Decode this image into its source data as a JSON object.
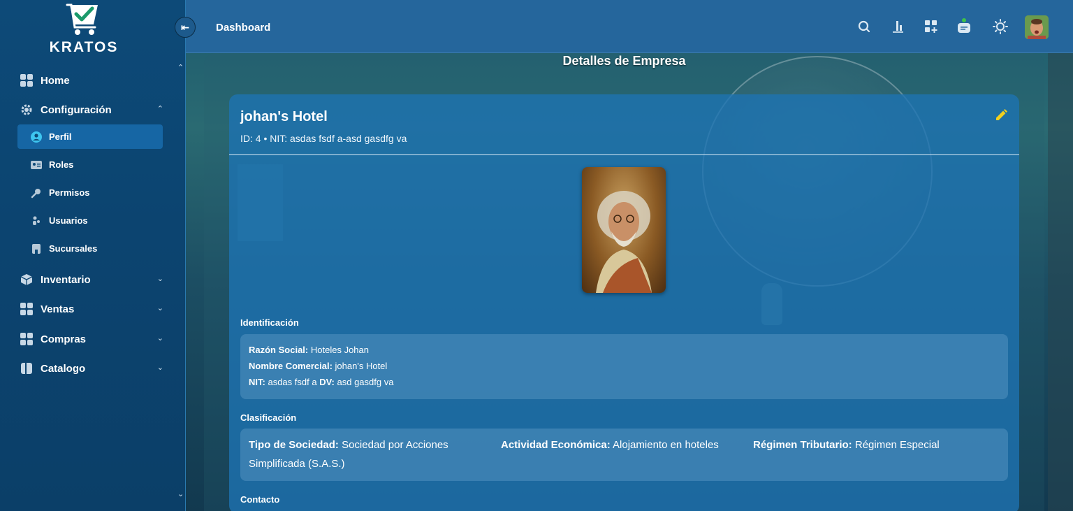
{
  "brand": {
    "name": "KRATOS"
  },
  "sidebar": {
    "items": [
      {
        "label": "Home",
        "icon": "grid-icon"
      },
      {
        "label": "Configuración",
        "icon": "gear-icon",
        "expanded": true
      },
      {
        "label": "Inventario",
        "icon": "box-icon"
      },
      {
        "label": "Ventas",
        "icon": "grid-icon"
      },
      {
        "label": "Compras",
        "icon": "grid-icon"
      },
      {
        "label": "Catalogo",
        "icon": "book-icon"
      }
    ],
    "sub_items": [
      {
        "label": "Perfil",
        "icon": "user-circle-icon",
        "active": true
      },
      {
        "label": "Roles",
        "icon": "id-card-icon"
      },
      {
        "label": "Permisos",
        "icon": "key-icon"
      },
      {
        "label": "Usuarios",
        "icon": "users-icon"
      },
      {
        "label": "Sucursales",
        "icon": "building-icon"
      }
    ]
  },
  "header": {
    "title": "Dashboard",
    "icons": [
      "search-icon",
      "bar-chart-icon",
      "add-widget-icon",
      "chat-icon",
      "sun-icon"
    ]
  },
  "main": {
    "section_title": "Detalles de Empresa",
    "company": {
      "name": "johan's Hotel",
      "subtitle": "ID: 4 • NIT: asdas fsdf a-asd gasdfg va"
    },
    "identificacion": {
      "label": "Identificación",
      "razon_social_label": "Razón Social:",
      "razon_social": "Hoteles Johan",
      "nombre_comercial_label": "Nombre Comercial:",
      "nombre_comercial": "johan's Hotel",
      "nit_label": "NIT:",
      "nit": "asdas fsdf a",
      "dv_label": "DV:",
      "dv": "asd gasdfg va"
    },
    "clasificacion": {
      "label": "Clasificación",
      "tipo_label": "Tipo de Sociedad:",
      "tipo": "Sociedad por Acciones Simplificada (S.A.S.)",
      "actividad_label": "Actividad Económica:",
      "actividad": "Alojamiento en hoteles",
      "regimen_label": "Régimen Tributario:",
      "regimen": "Régimen Especial"
    },
    "contacto": {
      "label": "Contacto"
    }
  },
  "colors": {
    "sidebar_bg": "#0c4470",
    "header_bg": "#25669c",
    "active_item": "#1666a4",
    "card_bg": "#1d73b4",
    "edit_icon": "#f2d01e",
    "status_dot": "#3ec24a"
  }
}
